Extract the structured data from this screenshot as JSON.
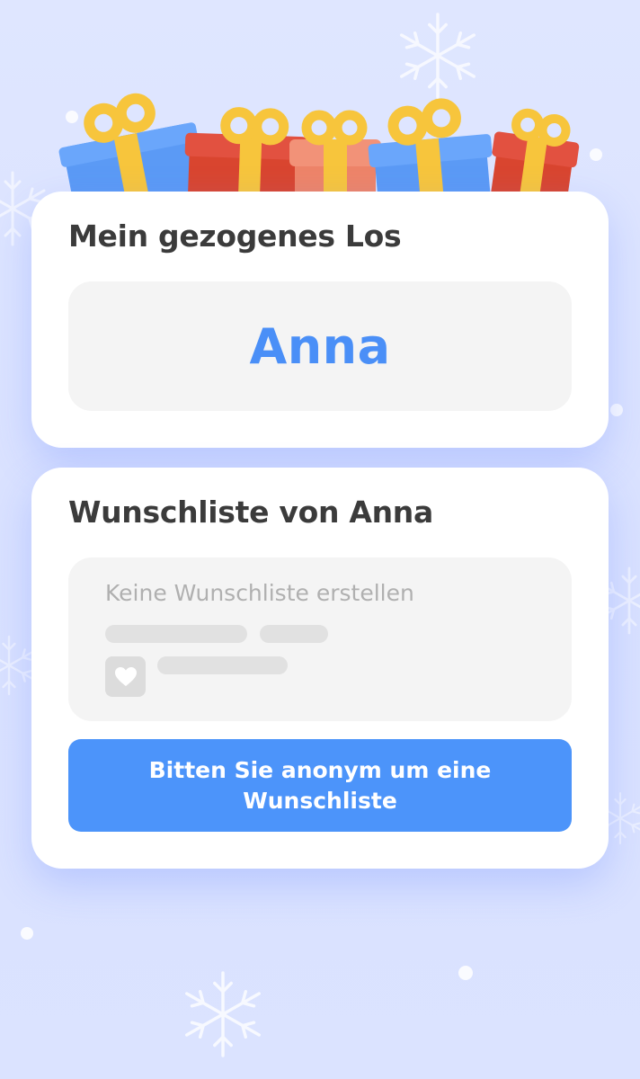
{
  "colors": {
    "background": "#dbe2ff",
    "card": "#ffffff",
    "accent_blue": "#4c94fa",
    "name_blue": "#4a8ff7",
    "title_text": "#3b3b3b",
    "placeholder_text": "#b0b0b0",
    "gift_blue": "#5b9af5",
    "gift_red": "#df4f3e",
    "gift_salmon": "#ef8a70",
    "ribbon_yellow": "#f7c53c"
  },
  "drawn_card": {
    "title": "Mein gezogenes Los",
    "name": "Anna"
  },
  "wishlist_card": {
    "title": "Wunschliste von Anna",
    "empty_text": "Keine Wunschliste erstellen",
    "button_label": "Bitten Sie anonym um eine Wunschliste",
    "item_icon": "heart-icon"
  },
  "decorations": {
    "gifts": [
      "blue",
      "red",
      "salmon",
      "blue",
      "red"
    ],
    "snowflakes": "snowflake-icon"
  }
}
